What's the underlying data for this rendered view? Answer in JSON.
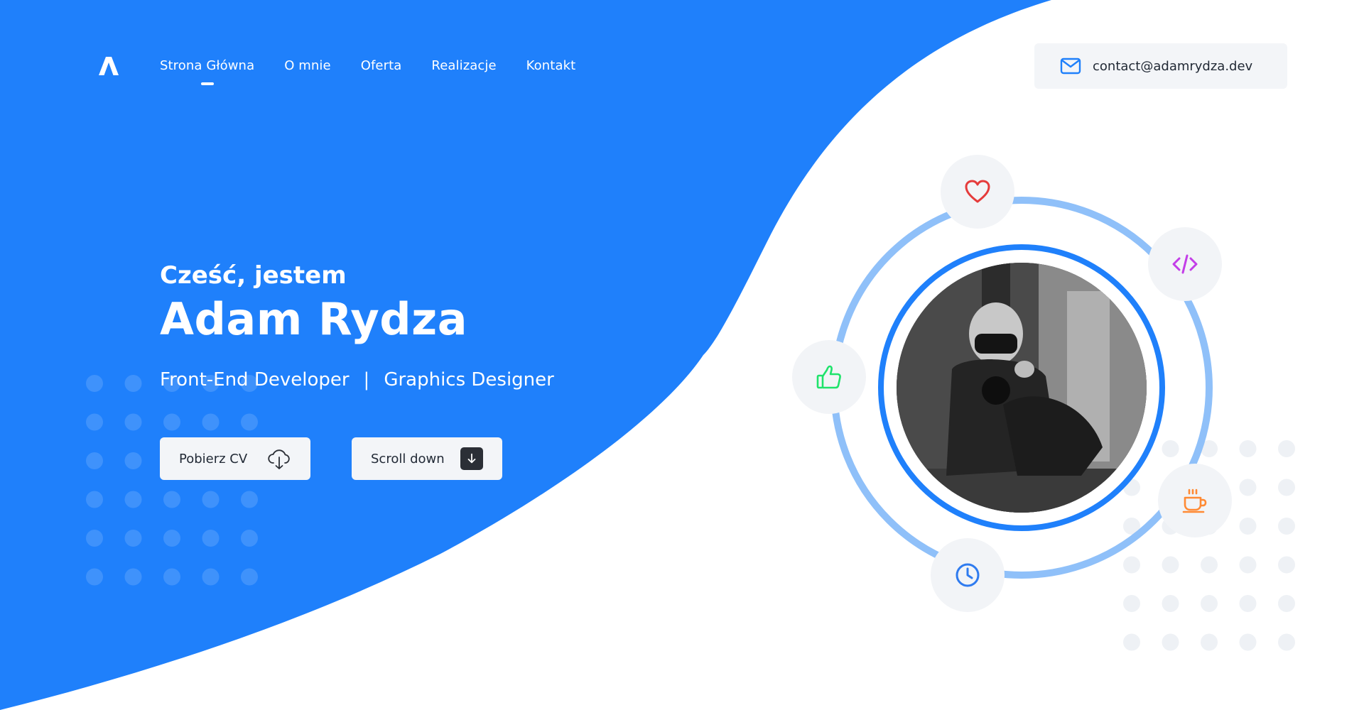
{
  "nav": {
    "items": [
      {
        "label": "Strona Główna",
        "active": true
      },
      {
        "label": "O mnie",
        "active": false
      },
      {
        "label": "Oferta",
        "active": false
      },
      {
        "label": "Realizacje",
        "active": false
      },
      {
        "label": "Kontakt",
        "active": false
      }
    ]
  },
  "contact": {
    "email": "contact@adamrydza.dev",
    "icon": "mail-icon"
  },
  "hero": {
    "greeting": "Cześć, jestem",
    "name": "Adam Rydza",
    "role1": "Front-End Developer",
    "separator": "|",
    "role2": "Graphics Designer"
  },
  "buttons": {
    "cv_label": "Pobierz CV",
    "cv_icon": "cloud-download-icon",
    "scroll_label": "Scroll down",
    "scroll_icon": "arrow-down-icon"
  },
  "orbit_icons": [
    "heart-icon",
    "code-icon",
    "thumbs-up-icon",
    "coffee-icon",
    "clock-icon"
  ],
  "colors": {
    "brand_blue": "#1f80fb",
    "ring_light_blue": "#8fc0f9",
    "button_bg": "#f3f5f8",
    "text_dark": "#222a36",
    "heart": "#e53b3b",
    "code": "#c33ee8",
    "thumbs": "#1fe36b",
    "coffee": "#ff8a34",
    "clock": "#2f7bef"
  }
}
